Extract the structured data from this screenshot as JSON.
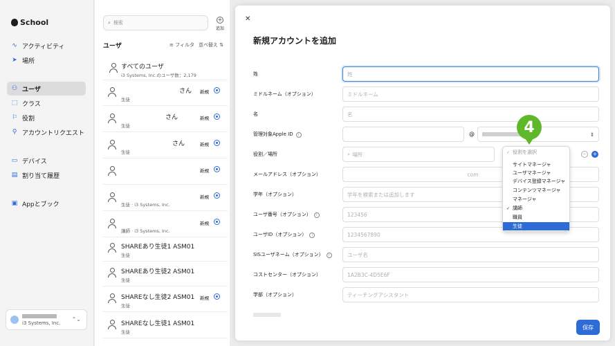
{
  "sidebar": {
    "brand": "School",
    "items": [
      {
        "label": "アクティビティ",
        "icon": "activity-icon"
      },
      {
        "label": "場所",
        "icon": "location-arrow-icon"
      },
      {
        "label": "ユーザ",
        "icon": "users-icon"
      },
      {
        "label": "クラス",
        "icon": "class-icon"
      },
      {
        "label": "役割",
        "icon": "flag-icon"
      },
      {
        "label": "アカウントリクエスト",
        "icon": "person-request-icon"
      },
      {
        "label": "デバイス",
        "icon": "laptop-icon"
      },
      {
        "label": "割り当て履歴",
        "icon": "history-icon"
      },
      {
        "label": "Appとブック",
        "icon": "app-icon"
      }
    ],
    "account_org": "i3 Systems, Inc."
  },
  "userlist": {
    "search_placeholder": "検索",
    "add_label": "追加",
    "title": "ユーザ",
    "filter_label": "フィルタ",
    "sort_label": "並べ替え",
    "all_users": {
      "name": "すべてのユーザ",
      "sub": "i3 Systems, Inc.のユーザ数：2,179"
    },
    "rows": [
      {
        "name": "さん",
        "sub": "生徒",
        "badge": "新規"
      },
      {
        "name": "さん",
        "sub": "生徒",
        "badge": "新規"
      },
      {
        "name": "さん",
        "sub": "生徒",
        "badge": "新規"
      },
      {
        "name": "",
        "sub": "",
        "badge": "新規"
      },
      {
        "name": "",
        "sub": "生徒 · i3 Systems, Inc.",
        "badge": "新規"
      },
      {
        "name": "",
        "sub": "講師 · i3 Systems, Inc.",
        "badge": "新規"
      },
      {
        "name": "SHAREあり生徒1 ASM01",
        "sub": "生徒",
        "badge": ""
      },
      {
        "name": "SHAREあり生徒2 ASM01",
        "sub": "生徒",
        "badge": ""
      },
      {
        "name": "SHAREなし生徒2 ASM01",
        "sub": "生徒",
        "badge": "新規"
      },
      {
        "name": "SHAREなし生徒1 ASM01",
        "sub": "生徒",
        "badge": ""
      }
    ]
  },
  "modal": {
    "title": "新規アカウントを追加",
    "fields": [
      {
        "label": "姓",
        "placeholder": "姓"
      },
      {
        "label": "ミドルネーム（オプション）",
        "placeholder": "ミドルネーム"
      },
      {
        "label": "名",
        "placeholder": "名"
      },
      {
        "label": "管理対象Apple ID",
        "placeholder": ""
      },
      {
        "label": "役割／場所",
        "placeholder": "場所"
      },
      {
        "label": "メールアドレス（オプション）",
        "placeholder": "com"
      },
      {
        "label": "学年（オプション）",
        "placeholder": "学年を検索または追加します"
      },
      {
        "label": "ユーザ番号（オプション）",
        "placeholder": "123456"
      },
      {
        "label": "ユーザID（オプション）",
        "placeholder": "1234567890"
      },
      {
        "label": "SISユーザネーム（オプション）",
        "placeholder": "ユーザ名"
      },
      {
        "label": "コストセンター（オプション）",
        "placeholder": "1A2B3C-4D5E6F"
      },
      {
        "label": "学部（オプション）",
        "placeholder": "ティーチングアシスタント"
      }
    ],
    "at_sign": "@",
    "save_label": "保存",
    "role_dropdown": {
      "placeholder": "役割を選択",
      "options": [
        "サイトマネージャ",
        "ユーザマネージャ",
        "デバイス登録マネージャ",
        "コンテンツマネージャ",
        "マネージャ",
        "講師",
        "職員",
        "生徒"
      ],
      "checked": "講師",
      "highlighted": "生徒"
    }
  },
  "step_badge": "4",
  "colors": {
    "accent": "#2d6bd6",
    "badge_green": "#5fb82a"
  }
}
